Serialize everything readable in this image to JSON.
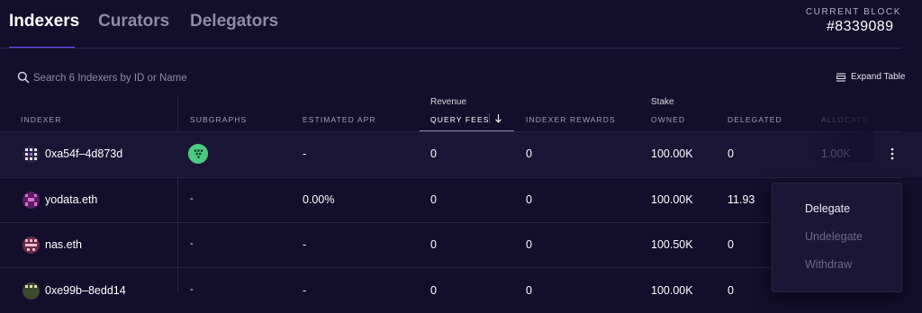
{
  "tabs": [
    {
      "label": "Indexers",
      "active": true
    },
    {
      "label": "Curators",
      "active": false
    },
    {
      "label": "Delegators",
      "active": false
    }
  ],
  "current_block": {
    "label": "CURRENT BLOCK",
    "value": "#8339089"
  },
  "search": {
    "placeholder": "Search 6 Indexers by ID or Name",
    "value": ""
  },
  "expand_table": {
    "label": "Expand Table"
  },
  "table": {
    "groups": {
      "revenue": "Revenue",
      "stake": "Stake"
    },
    "columns": {
      "indexer": "INDEXER",
      "subgraphs": "SUBGRAPHS",
      "estimated_apr": "ESTIMATED APR",
      "query_fees": "QUERY FEES",
      "indexer_rewards": "INDEXER REWARDS",
      "owned": "OWNED",
      "delegated": "DELEGATED",
      "allocated": "ALLOCATE"
    },
    "sort": {
      "column": "query_fees",
      "direction": "descending",
      "icon": "arrow-down-icon"
    },
    "rows": [
      {
        "name": "0xa54f–4d873d",
        "subgraphs": "",
        "subgraph_icon": "subgraph-logo-icon",
        "apr": "-",
        "query_fees": "0",
        "indexer_rewards": "0",
        "owned": "100.00K",
        "delegated": "0",
        "allocated": "1.00K"
      },
      {
        "name": "yodata.eth",
        "subgraphs": "-",
        "apr": "0.00%",
        "query_fees": "0",
        "indexer_rewards": "0",
        "owned": "100.00K",
        "delegated": "11.93",
        "allocated": ""
      },
      {
        "name": "nas.eth",
        "subgraphs": "-",
        "apr": "-",
        "query_fees": "0",
        "indexer_rewards": "0",
        "owned": "100.50K",
        "delegated": "0",
        "allocated": ""
      },
      {
        "name": "0xe99b–8edd14",
        "subgraphs": "-",
        "apr": "-",
        "query_fees": "0",
        "indexer_rewards": "0",
        "owned": "100.00K",
        "delegated": "0",
        "allocated": ""
      }
    ]
  },
  "row_menu": {
    "items": [
      {
        "label": "Delegate",
        "enabled": true
      },
      {
        "label": "Undelegate",
        "enabled": false
      },
      {
        "label": "Withdraw",
        "enabled": false
      }
    ]
  },
  "colors": {
    "background": "#130e2b",
    "accent": "#6f4cff",
    "subgraph_green": "#4bca81",
    "muted_text": "#8f8ba3"
  }
}
